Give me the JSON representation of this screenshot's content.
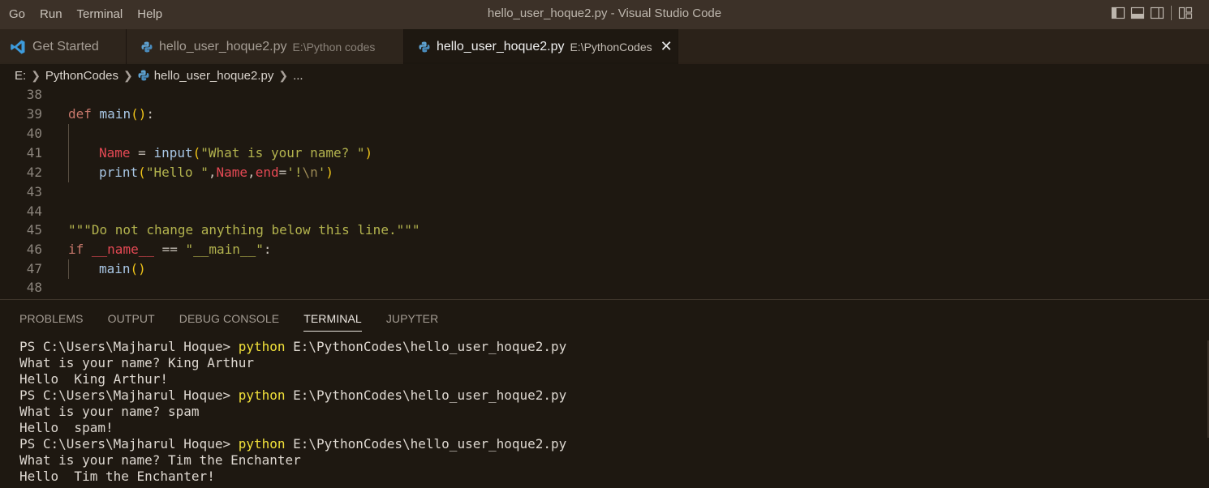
{
  "menu": [
    "Go",
    "Run",
    "Terminal",
    "Help"
  ],
  "window_title": "hello_user_hoque2.py - Visual Studio Code",
  "tabs": [
    {
      "label": "Get Started",
      "desc": "",
      "icon": "vscode-icon"
    },
    {
      "label": "hello_user_hoque2.py",
      "desc": "E:\\Python codes",
      "icon": "python-icon"
    },
    {
      "label": "hello_user_hoque2.py",
      "desc": "E:\\PythonCodes",
      "icon": "python-icon",
      "close": "✕"
    }
  ],
  "breadcrumb": {
    "drive": "E:",
    "folder": "PythonCodes",
    "file": "hello_user_hoque2.py",
    "more": "..."
  },
  "editor": {
    "line_numbers": [
      "38",
      "39",
      "40",
      "41",
      "42",
      "43",
      "44",
      "45",
      "46",
      "47",
      "48"
    ],
    "lines": {
      "l39": {
        "kw": "def",
        "name": "main",
        "open": "(",
        "close": ")",
        "colon": ":"
      },
      "l41": {
        "var": "Name",
        "eq": " = ",
        "fn": "input",
        "open": "(",
        "str": "\"What is your name? \"",
        "close": ")"
      },
      "l42": {
        "fn": "print",
        "open": "(",
        "str1": "\"Hello \"",
        "comma1": ",",
        "var1": "Name",
        "comma2": ",",
        "var2": "end",
        "eq": "=",
        "str2a": "'!",
        "esc": "\\n",
        "str2b": "'",
        "close": ")"
      },
      "l45": {
        "str": "\"\"\"Do not change anything below this line.\"\"\""
      },
      "l46": {
        "kw": "if",
        "var": "__name__",
        "op": " == ",
        "str": "\"__main__\"",
        "colon": ":"
      },
      "l47": {
        "fn": "main",
        "open": "(",
        "close": ")"
      }
    }
  },
  "panel": {
    "tabs": [
      "PROBLEMS",
      "OUTPUT",
      "DEBUG CONSOLE",
      "TERMINAL",
      "JUPYTER"
    ],
    "active_tab": "TERMINAL",
    "terminal": {
      "prompt": "PS C:\\Users\\Majharul Hoque> ",
      "cmd": "python",
      "arg": " E:\\PythonCodes\\hello_user_hoque2.py",
      "out": [
        "What is your name? King Arthur",
        "Hello  King Arthur!",
        "What is your name? spam",
        "Hello  spam!",
        "What is your name? Tim the Enchanter",
        "Hello  Tim the Enchanter!"
      ]
    }
  },
  "colors": {
    "accent_yellow": "#f0e03a",
    "keyword": "#c8786c",
    "variable": "#e54954",
    "string": "#b3b34e"
  }
}
